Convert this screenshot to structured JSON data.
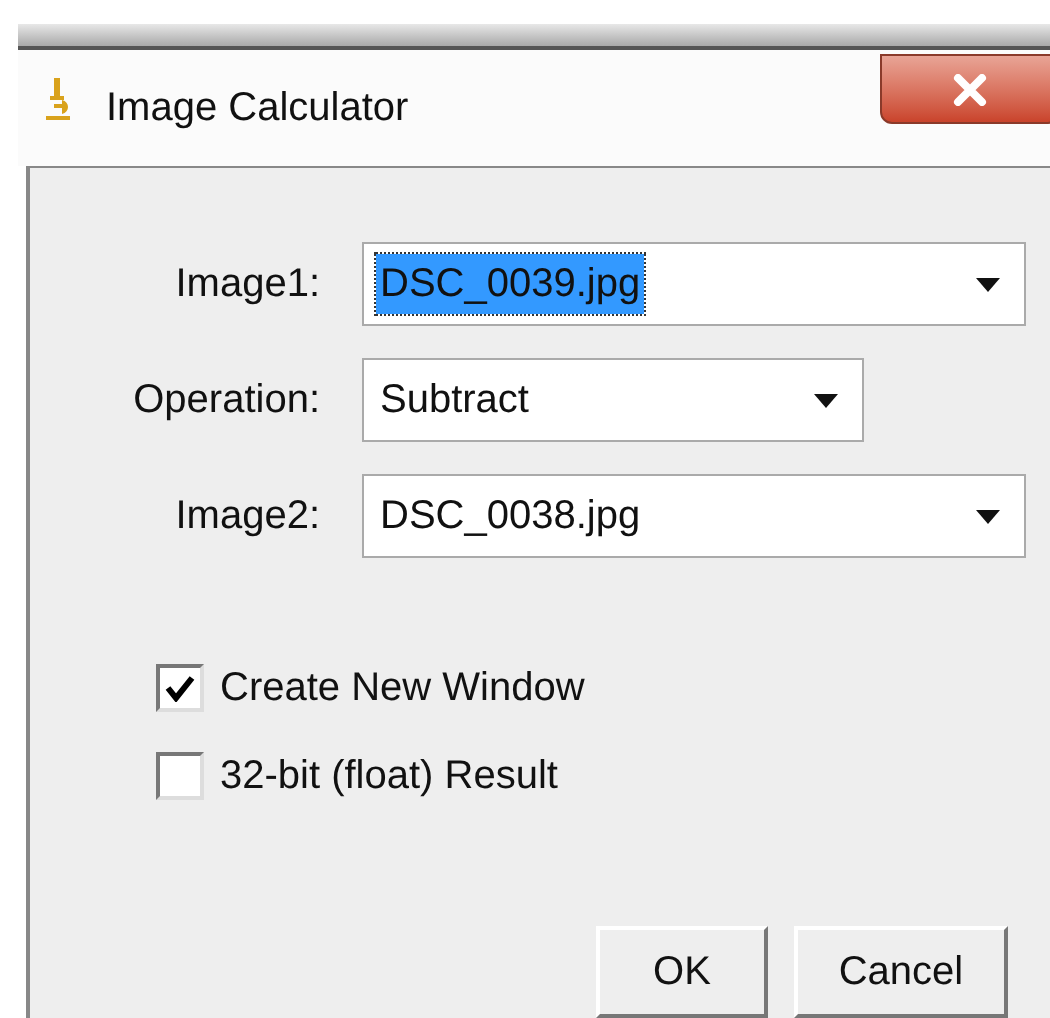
{
  "window": {
    "title": "Image Calculator"
  },
  "fields": [
    {
      "label": "Image1:",
      "value": "DSC_0039.jpg",
      "highlighted": true,
      "wide": true
    },
    {
      "label": "Operation:",
      "value": "Subtract",
      "highlighted": false,
      "wide": false
    },
    {
      "label": "Image2:",
      "value": "DSC_0038.jpg",
      "highlighted": false,
      "wide": true
    }
  ],
  "checkboxes": [
    {
      "label": "Create New Window",
      "checked": true
    },
    {
      "label": "32-bit (float) Result",
      "checked": false
    }
  ],
  "buttons": [
    "OK",
    "Cancel"
  ]
}
